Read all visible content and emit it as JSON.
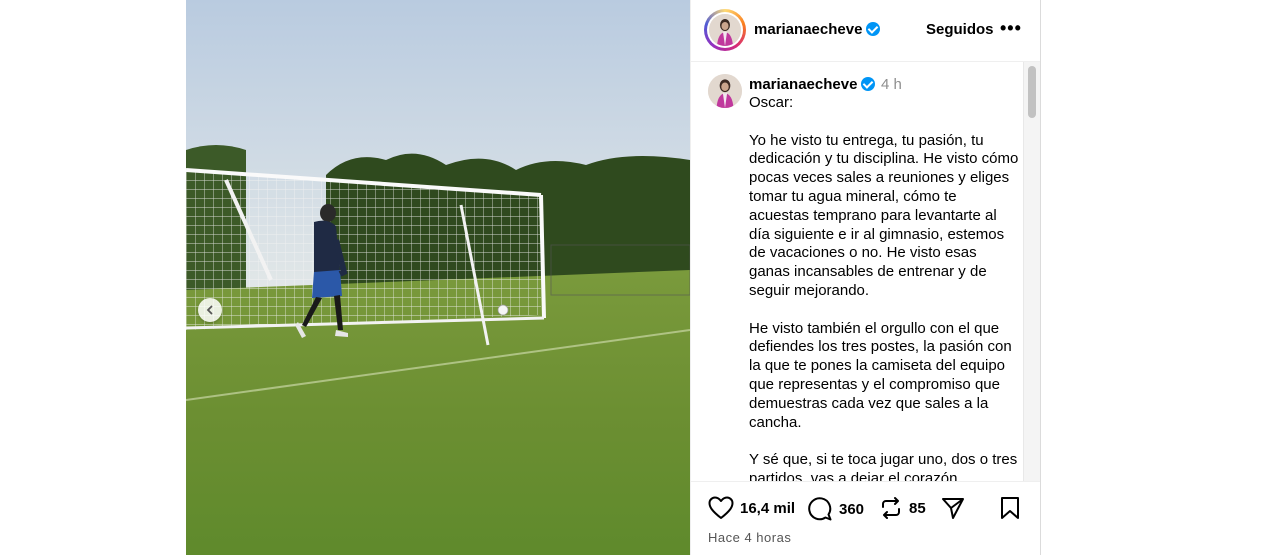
{
  "header": {
    "username": "marianaecheve",
    "follow_status": "Seguidos",
    "more_icon": "more-options-icon"
  },
  "caption": {
    "username": "marianaecheve",
    "time_ago": "4 h",
    "text": "Oscar:\n\nYo he visto tu entrega, tu pasión, tu dedicación y tu disciplina. He visto cómo pocas veces sales a reuniones y eliges tomar tu agua mineral, cómo te acuestas temprano para levantarte al día siguiente e ir al gimnasio, estemos de vacaciones o no. He visto esas ganas incansables de entrenar y de seguir mejorando.\n\nHe visto también el orgullo con el que defiendes los tres postes, la pasión con la que te pones la camiseta del equipo que representas y el compromiso que demuestras cada vez que sales a la cancha.\n\nY sé que, si te toca jugar uno, dos o tres partidos, vas a dejar el corazón"
  },
  "actions": {
    "likes": "16,4 mil",
    "comments": "360",
    "reposts": "85",
    "timestamp": "Hace 4 horas"
  },
  "colors": {
    "verified": "#0095f6",
    "grass": "#6b8f3a",
    "sky": "#c9d8e6"
  }
}
